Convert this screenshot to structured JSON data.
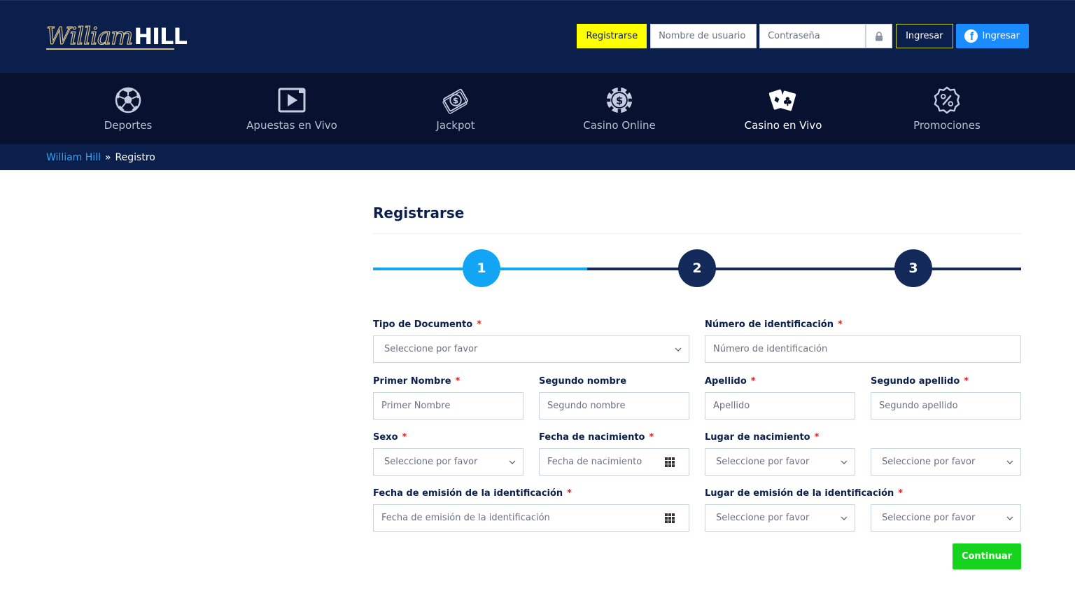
{
  "header": {
    "logo_script": "William",
    "logo_bold": "HILL",
    "register_label": "Registrarse",
    "username_placeholder": "Nombre de usuario",
    "password_placeholder": "Contraseña",
    "login_label": "Ingresar",
    "facebook_label": "Ingresar"
  },
  "nav": {
    "items": [
      {
        "label": "Deportes",
        "icon": "soccer-ball-icon"
      },
      {
        "label": "Apuestas en Vivo",
        "icon": "play-icon"
      },
      {
        "label": "Jackpot",
        "icon": "money-icon"
      },
      {
        "label": "Casino Online",
        "icon": "casino-chip-icon"
      },
      {
        "label": "Casino en Vivo",
        "icon": "playing-cards-icon"
      },
      {
        "label": "Promociones",
        "icon": "percent-badge-icon"
      }
    ],
    "active": "Casino en Vivo"
  },
  "breadcrumb": {
    "home": "William Hill",
    "separator": "»",
    "current": "Registro"
  },
  "form": {
    "title": "Registrarse",
    "steps": [
      "1",
      "2",
      "3"
    ],
    "current_step": 1,
    "fields": {
      "tipo_documento": {
        "label": "Tipo de Documento",
        "placeholder": "Seleccione por favor"
      },
      "numero_identificacion": {
        "label": "Número de identificación",
        "placeholder": "Número de identificación"
      },
      "primer_nombre": {
        "label": "Primer Nombre",
        "placeholder": "Primer Nombre"
      },
      "segundo_nombre": {
        "label": "Segundo nombre",
        "placeholder": "Segundo nombre"
      },
      "apellido": {
        "label": "Apellido",
        "placeholder": "Apellido"
      },
      "segundo_apellido": {
        "label": "Segundo apellido",
        "placeholder": "Segundo apellido"
      },
      "sexo": {
        "label": "Sexo",
        "placeholder": "Seleccione por favor"
      },
      "fecha_nacimiento": {
        "label": "Fecha de nacimiento",
        "placeholder": "Fecha de nacimiento"
      },
      "lugar_nacimiento": {
        "label": "Lugar de nacimiento",
        "placeholder": "Seleccione por favor",
        "placeholder2": "Seleccione por favor"
      },
      "fecha_emision": {
        "label": "Fecha de emisión de la identificación",
        "placeholder": "Fecha de emisión de la identificación"
      },
      "lugar_emision": {
        "label": "Lugar de emisión de la identificación",
        "placeholder": "Seleccione por favor",
        "placeholder2": "Seleccione por favor"
      }
    },
    "required_mark": "*",
    "continue_label": "Continuar"
  },
  "colors": {
    "header_bg": "#0b1f4d",
    "nav_bg": "#081230",
    "step_active": "#12a5f4",
    "step_inactive": "#13295a",
    "register_yellow": "#ffff00",
    "facebook_blue": "#1a8cff",
    "continue_green": "#16d41e",
    "required_red": "#e02424"
  }
}
